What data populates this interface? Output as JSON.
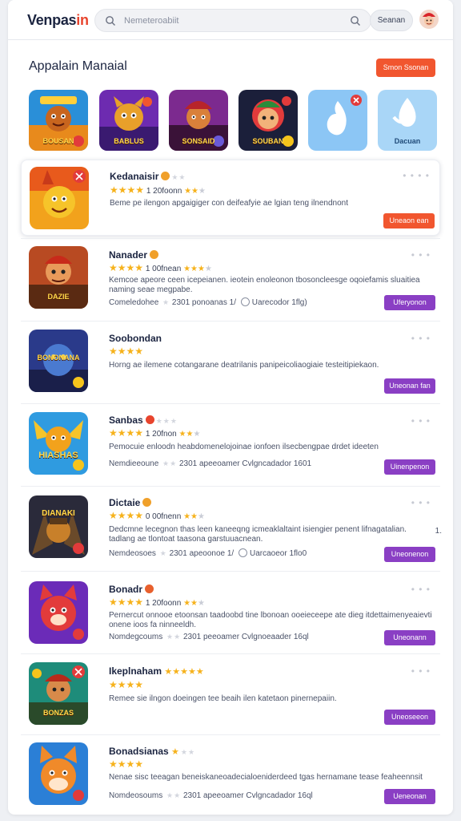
{
  "header": {
    "logo_main": "Venpas",
    "logo_accent": "in",
    "search_placeholder": "Nemeteroabiit",
    "search_button": "Seanan"
  },
  "section": {
    "title": "Appalain Manaial",
    "action": "Smon Ssonan"
  },
  "featured": [
    {
      "label": "BOUSAN",
      "bg": "#2a8fd8"
    },
    {
      "label": "BABLUS",
      "bg": "#6d2bb0"
    },
    {
      "label": "SONSAID",
      "bg": "#7c2a8f"
    },
    {
      "label": "SOUBAN",
      "bg": "#1b1f3a"
    },
    {
      "label": "",
      "bg": "#8cc6f5"
    },
    {
      "label": "Dacuan",
      "bg": "#a9d6f7"
    }
  ],
  "apps": [
    {
      "name": "Kedanaisir",
      "rating_text": "1 20foonn",
      "desc": "Beme pe ilengon apgaigiger con deifeafyie ae lgian teng ilnendnont",
      "meta": "",
      "action": "Uneaon ean",
      "action_color": "orange",
      "thumb_label": "",
      "thumb_bg": "#f2a21c"
    },
    {
      "name": "Nanader",
      "rating_text": "1 00fnean",
      "desc": "Kemcoe apeore ceen icepeianen. ieotein enoleonon tbosoncleesge oqoiefamis sluaitiea naming seae megpabe.",
      "meta_left": "Comeledohee",
      "meta_mid": "2301 ponoanas",
      "meta_right": "Uarecodor 1flg)",
      "action": "Uferyonon",
      "action_color": "purple",
      "thumb_label": "DAZIE",
      "thumb_bg": "#b84a22"
    },
    {
      "name": "Soobondan",
      "rating_text": "",
      "desc": "Horng ae ilemene cotangarane deatrilanis panipeicoliaogiaie testeitipiekaon.",
      "meta": "",
      "action": "Uneonan fan",
      "action_color": "purple",
      "thumb_label": "BONONANA",
      "thumb_bg": "#2a3a8a"
    },
    {
      "name": "Sanbas",
      "rating_text": "1 20fnon",
      "desc": "Pemocuie enloodn heabdomenelojoinae ionfoen ilsecbengpae drdet ideeten",
      "meta_left": "Nemdieeoune",
      "meta_mid": "2301 apeeoamer",
      "meta_right": "Cvlgncadador 1601",
      "action": "Uinenpenon",
      "action_color": "purple",
      "thumb_label": "HIASHAS",
      "thumb_bg": "#2f9be0"
    },
    {
      "name": "Dictaie",
      "rating_text": "0 00fnenn",
      "desc": "Dedcmne lecegnon thas leen kaneeqng icmeaklaltaint isiengier penent lifnagatalian. tadlang ae tlontoat taasona garstuuacnean.",
      "meta_left": "Nemdeosoes",
      "meta_mid": "2301 apeoonoe",
      "meta_right": "Uarcaoeor 1flo0",
      "side_note": "1.",
      "action": "Uneonenon",
      "action_color": "purple",
      "thumb_label": "DIANAKI",
      "thumb_bg": "#2a2a3a"
    },
    {
      "name": "Bonadr",
      "rating_text": "1 20foonn",
      "desc": "Pernercut onnooe etoonsan taadoobd tine lbonoan ooeieceepe ate dieg itdettaimenyeaievti onene ioos fa ninneeldh.",
      "meta_left": "Nomdegcoums",
      "meta_mid": "2301 peeoamer",
      "meta_right": "Cvlgnoeaader 16ql",
      "action": "Uneonann",
      "action_color": "purple",
      "thumb_label": "",
      "thumb_bg": "#6b2bb8"
    },
    {
      "name": "Ikeplnaham",
      "rating_text": "",
      "desc": "Remee sie ilngon doeingen tee beaih ilen katetaon pinernepaiin.",
      "meta": "",
      "action": "Uneoseeon",
      "action_color": "purple",
      "thumb_label": "BONZAS",
      "thumb_bg": "#1e8c7a"
    },
    {
      "name": "Bonadsianas",
      "rating_text": "",
      "desc": "Nenae sisc teeagan beneiskaneoadecialoeniderdeed tgas hernamane tease feaheennsit",
      "meta_left": "Nomdeosoums",
      "meta_mid": "2301 apeeoamer",
      "meta_right": "Cvlgncadador 16ql",
      "action": "Ueneonan",
      "action_color": "purple",
      "thumb_label": "",
      "thumb_bg": "#2b7fd6"
    }
  ],
  "colors": {
    "accent_orange": "#f1562f",
    "accent_purple": "#8a3fc4",
    "star": "#f6b21c"
  }
}
